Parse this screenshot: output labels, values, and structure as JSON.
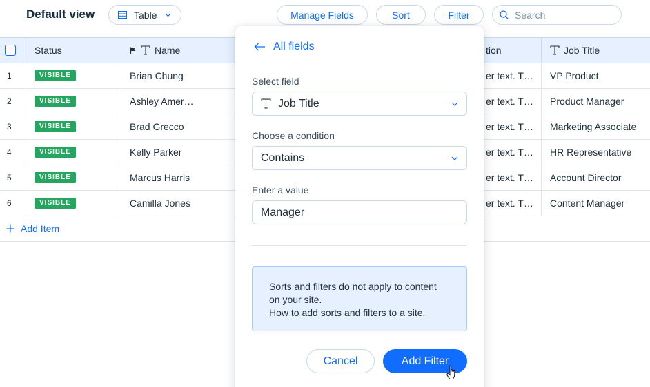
{
  "header": {
    "view_title": "Default view",
    "view_mode": "Table",
    "manage_fields_label": "Manage Fields",
    "sort_label": "Sort",
    "filter_label": "Filter",
    "search_placeholder": "Search"
  },
  "table": {
    "columns": {
      "status": "Status",
      "name": "Name",
      "description_partial": "tion",
      "job_title": "Job Title"
    },
    "rows": [
      {
        "num": "1",
        "status": "VISIBLE",
        "name": "Brian Chung",
        "description": "er text. T…",
        "job_title": "VP Product"
      },
      {
        "num": "2",
        "status": "VISIBLE",
        "name": "Ashley Amer…",
        "description": "er text. T…",
        "job_title": "Product Manager"
      },
      {
        "num": "3",
        "status": "VISIBLE",
        "name": "Brad Grecco",
        "description": "er text. T…",
        "job_title": "Marketing Associate"
      },
      {
        "num": "4",
        "status": "VISIBLE",
        "name": "Kelly Parker",
        "description": "er text. T…",
        "job_title": "HR Representative"
      },
      {
        "num": "5",
        "status": "VISIBLE",
        "name": "Marcus Harris",
        "description": "er text. T…",
        "job_title": "Account Director"
      },
      {
        "num": "6",
        "status": "VISIBLE",
        "name": "Camilla Jones",
        "description": "er text. T…",
        "job_title": "Content Manager"
      }
    ],
    "add_item_label": "Add Item"
  },
  "filter_panel": {
    "back_label": "All fields",
    "select_field_label": "Select field",
    "selected_field": "Job Title",
    "condition_label": "Choose a condition",
    "selected_condition": "Contains",
    "value_label": "Enter a value",
    "value": "Manager",
    "info_text": "Sorts and filters do not apply to content on your site.",
    "info_link": "How to add sorts and filters to a site.",
    "cancel_label": "Cancel",
    "add_filter_label": "Add Filter"
  },
  "colors": {
    "accent": "#116dff",
    "badge_green": "#25a55f",
    "header_bg": "#e7f0ff"
  },
  "icons": [
    "table-icon",
    "chevron-down-icon",
    "search-icon",
    "flag-icon",
    "text-field-icon",
    "plus-icon",
    "arrow-left-icon",
    "pointer-cursor-icon"
  ]
}
